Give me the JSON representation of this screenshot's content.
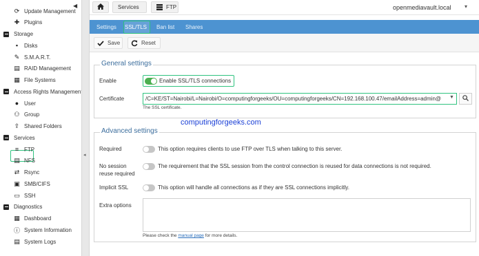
{
  "sidebar": {
    "collapse_glyph": "◀",
    "items": [
      {
        "kind": "item",
        "label": "Update Management",
        "icon": "update-icon"
      },
      {
        "kind": "item",
        "label": "Plugins",
        "icon": "plugin-icon"
      },
      {
        "kind": "group",
        "label": "Storage"
      },
      {
        "kind": "item",
        "label": "Disks",
        "icon": "disk-icon"
      },
      {
        "kind": "item",
        "label": "S.M.A.R.T.",
        "icon": "smart-icon"
      },
      {
        "kind": "item",
        "label": "RAID Management",
        "icon": "raid-icon"
      },
      {
        "kind": "item",
        "label": "File Systems",
        "icon": "filesystem-icon"
      },
      {
        "kind": "group",
        "label": "Access Rights Management"
      },
      {
        "kind": "item",
        "label": "User",
        "icon": "user-icon"
      },
      {
        "kind": "item",
        "label": "Group",
        "icon": "group-icon"
      },
      {
        "kind": "item",
        "label": "Shared Folders",
        "icon": "share-icon"
      },
      {
        "kind": "group",
        "label": "Services"
      },
      {
        "kind": "item",
        "label": "FTP",
        "icon": "ftp-icon",
        "selected": true
      },
      {
        "kind": "item",
        "label": "NFS",
        "icon": "nfs-icon"
      },
      {
        "kind": "item",
        "label": "Rsync",
        "icon": "rsync-icon"
      },
      {
        "kind": "item",
        "label": "SMB/CIFS",
        "icon": "smb-icon"
      },
      {
        "kind": "item",
        "label": "SSH",
        "icon": "ssh-icon"
      },
      {
        "kind": "group",
        "label": "Diagnostics"
      },
      {
        "kind": "item",
        "label": "Dashboard",
        "icon": "dashboard-icon"
      },
      {
        "kind": "item",
        "label": "System Information",
        "icon": "info-icon"
      },
      {
        "kind": "item",
        "label": "System Logs",
        "icon": "logs-icon"
      }
    ]
  },
  "splitter": {
    "arrow_glyph": "◂"
  },
  "topbar": {
    "breadcrumb": {
      "services": "Services",
      "ftp": "FTP"
    },
    "hostname": "openmediavault.local",
    "host_menu_glyph": "▾"
  },
  "tabs": {
    "settings": "Settings",
    "ssl_tls": "SSL/TLS",
    "ban_list": "Ban list",
    "shares": "Shares"
  },
  "toolbar": {
    "save_label": "Save",
    "reset_label": "Reset"
  },
  "general": {
    "legend": "General settings",
    "enable_label": "Enable",
    "enable_toggle_text": "Enable SSL/TLS connections",
    "enable_on": true,
    "certificate_label": "Certificate",
    "certificate_value": "/C=KE/ST=Nairobi/L=Nairobi/O=computingforgeeks/OU=computingforgeeks/CN=192.168.100.47/emailAddress=admin@",
    "certificate_hint": "The SSL certificate."
  },
  "watermark": "computingforgeeks.com",
  "advanced": {
    "legend": "Advanced settings",
    "required_label": "Required",
    "required_desc": "This option requires clients to use FTP over TLS when talking to this server.",
    "no_reuse_label_1": "No session",
    "no_reuse_label_2": "reuse required",
    "no_reuse_desc": "The requirement that the SSL session from the control connection is reused for data connections is not required.",
    "implicit_label": "Implicit SSL",
    "implicit_desc": "This option will handle all connections as if they are SSL connections implicitly.",
    "extra_label": "Extra options",
    "extra_value": "",
    "extra_hint_prefix": "Please check the",
    "extra_hint_link": "manual page",
    "extra_hint_suffix": "for more details."
  },
  "colors": {
    "tab_bar": "#4d93d1",
    "highlight": "#2ec27e",
    "toggle_on": "#4caf50",
    "legend": "#3b6d9c"
  }
}
